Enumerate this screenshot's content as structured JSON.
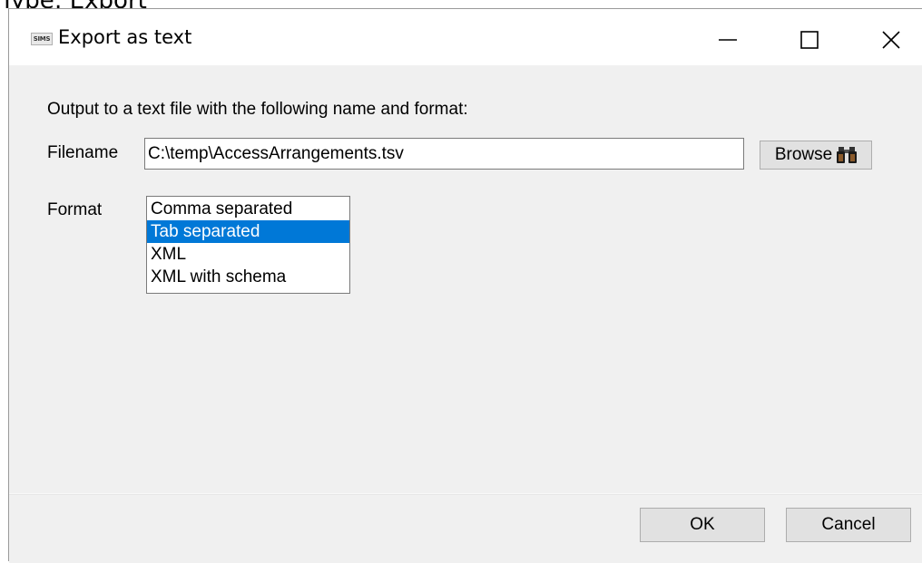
{
  "backdrop": {
    "partial_text": "Type: Export"
  },
  "window": {
    "icon_label": "SIMS",
    "title": "Export as text",
    "controls": {
      "minimize_icon": "minimize-icon",
      "maximize_icon": "maximize-icon",
      "close_icon": "close-icon"
    }
  },
  "form": {
    "prompt": "Output to a text file with the following name and format:",
    "filename_label": "Filename",
    "filename_value": "C:\\temp\\AccessArrangements.tsv",
    "browse_label": "Browse",
    "browse_icon": "binoculars-icon",
    "format_label": "Format",
    "format_options": [
      "Comma separated",
      "Tab separated",
      "XML",
      "XML with schema"
    ],
    "format_selected": "Tab separated"
  },
  "footer": {
    "ok_label": "OK",
    "cancel_label": "Cancel"
  },
  "colors": {
    "selection": "#0078d7",
    "window_bg": "#f0f0f0",
    "button_bg": "#e1e1e1"
  }
}
